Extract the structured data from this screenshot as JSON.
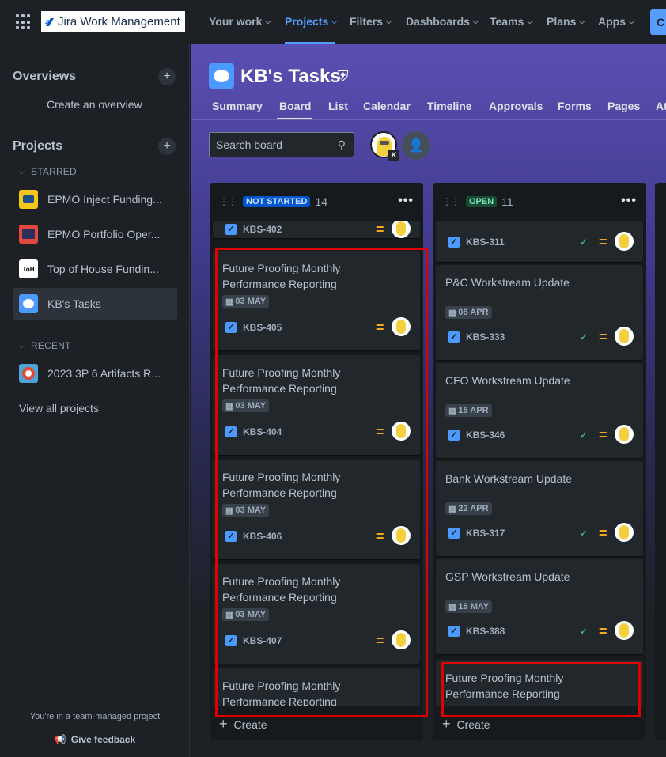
{
  "topnav": {
    "app_name": "Jira Work Management",
    "items": [
      {
        "label": "Your work"
      },
      {
        "label": "Projects"
      },
      {
        "label": "Filters"
      },
      {
        "label": "Dashboards"
      },
      {
        "label": "Teams"
      },
      {
        "label": "Plans"
      },
      {
        "label": "Apps"
      }
    ],
    "active": "Projects",
    "create_label": "C"
  },
  "sidebar": {
    "overviews_title": "Overviews",
    "create_overview": "Create an overview",
    "projects_title": "Projects",
    "starred_label": "STARRED",
    "starred": [
      {
        "label": "EPMO Inject Funding...",
        "icon": "wallet-icon"
      },
      {
        "label": "EPMO Portfolio Oper...",
        "icon": "dashboard-icon"
      },
      {
        "label": "Top of House Fundin...",
        "icon": "house-icon",
        "icon_text": "ToH"
      },
      {
        "label": "KB's Tasks",
        "icon": "koala-icon"
      }
    ],
    "recent_label": "RECENT",
    "recent": [
      {
        "label": "2023 3P 6 Artifacts R...",
        "icon": "lifebuoy-icon"
      }
    ],
    "view_all": "View all projects",
    "footer_note": "You're in a team-managed project",
    "feedback": "Give feedback"
  },
  "project": {
    "title": "KB's Tasks",
    "tabs": [
      "Summary",
      "Board",
      "List",
      "Calendar",
      "Timeline",
      "Approvals",
      "Forms",
      "Pages",
      "At"
    ],
    "active_tab": "Board",
    "search_placeholder": "Search board",
    "avatar_badge": "K"
  },
  "columns": [
    {
      "status": "NOT STARTED",
      "count": "14",
      "lozenge_bg": "#0055cc",
      "lozenge_fg": "#cce0ff",
      "cards": [
        {
          "title": "",
          "date": "",
          "key": "KBS-402",
          "done": false
        },
        {
          "title": "Future Proofing Monthly Performance Reporting",
          "date": "03 MAY",
          "key": "KBS-405",
          "done": false
        },
        {
          "title": "Future Proofing Monthly Performance Reporting",
          "date": "03 MAY",
          "key": "KBS-404",
          "done": false
        },
        {
          "title": "Future Proofing Monthly Performance Reporting",
          "date": "03 MAY",
          "key": "KBS-406",
          "done": false
        },
        {
          "title": "Future Proofing Monthly Performance Reporting",
          "date": "03 MAY",
          "key": "KBS-407",
          "done": false
        },
        {
          "title": "Future Proofing Monthly Performance Reporting",
          "date": "",
          "key": "",
          "done": false
        }
      ],
      "create_label": "Create"
    },
    {
      "status": "OPEN",
      "count": "11",
      "lozenge_bg": "#164b35",
      "lozenge_fg": "#7ee2b8",
      "cards": [
        {
          "title": "",
          "date": "",
          "key": "KBS-311",
          "done": true
        },
        {
          "title": "P&C Workstream Update",
          "date": "08 APR",
          "key": "KBS-333",
          "done": true
        },
        {
          "title": "CFO Workstream Update",
          "date": "15 APR",
          "key": "KBS-346",
          "done": true
        },
        {
          "title": "Bank Workstream Update",
          "date": "22 APR",
          "key": "KBS-317",
          "done": true
        },
        {
          "title": "GSP Workstream Update",
          "date": "15 MAY",
          "key": "KBS-388",
          "done": true
        },
        {
          "title": "Future Proofing Monthly Performance Reporting",
          "date": "",
          "key": "",
          "done": false
        }
      ],
      "create_label": "Create"
    }
  ],
  "colors": {
    "highlight": "#e00000",
    "priority": "#f5a623",
    "done_check": "#4bce97",
    "accent": "#579dff"
  }
}
